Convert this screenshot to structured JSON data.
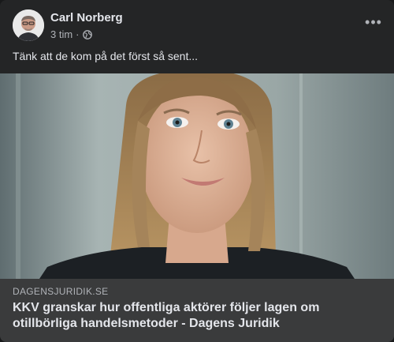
{
  "post": {
    "author": "Carl Norberg",
    "time": "3 tim",
    "separator": "·",
    "privacy_icon": "globe-icon",
    "more_icon": "more-options-icon",
    "more_label": "•••",
    "text": "Tänk att de kom på det först så sent...",
    "image": "photo-woman-portrait"
  },
  "link_preview": {
    "domain": "DAGENSJURIDIK.SE",
    "title": "KKV granskar hur offentliga aktörer följer lagen om otillbörliga handelsmetoder - Dagens Juridik"
  },
  "colors": {
    "card_bg": "#242526",
    "link_bg": "#3a3b3c",
    "primary_text": "#e4e6eb",
    "secondary_text": "#b0b3b8"
  }
}
